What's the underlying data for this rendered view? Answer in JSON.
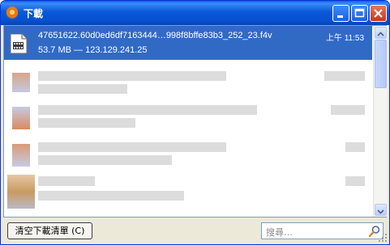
{
  "window": {
    "title": "下載"
  },
  "download": {
    "filename": "47651622.60d0ed6df7163444…998f8bffe83b3_252_23.f4v",
    "meta": "53.7 MB — 123.129.241.25",
    "time": "上午 11:53"
  },
  "footer": {
    "clear_button": "清空下載清單 (C)",
    "search_placeholder": "搜尋…"
  }
}
